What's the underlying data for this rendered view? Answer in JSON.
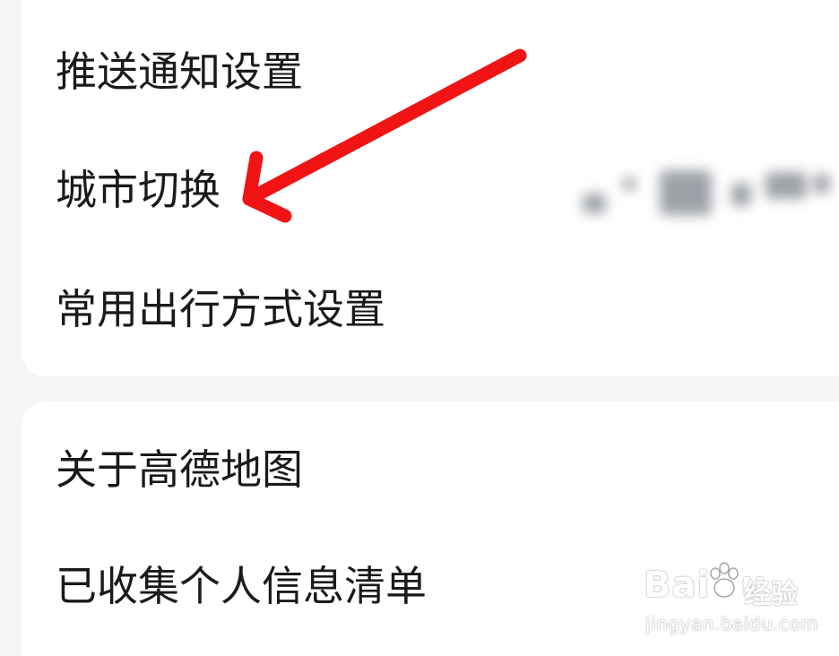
{
  "settings_group_1": {
    "items": [
      {
        "label": "推送通知设置"
      },
      {
        "label": "城市切换"
      },
      {
        "label": "常用出行方式设置"
      }
    ]
  },
  "settings_group_2": {
    "items": [
      {
        "label": "关于高德地图"
      },
      {
        "label": "已收集个人信息清单"
      }
    ]
  },
  "annotation": {
    "arrow_color": "#f01414"
  },
  "watermark": {
    "logo_text": "Bai",
    "logo_text_2": "u",
    "brand_suffix": "经验",
    "url": "jingyan.baidu.com"
  }
}
